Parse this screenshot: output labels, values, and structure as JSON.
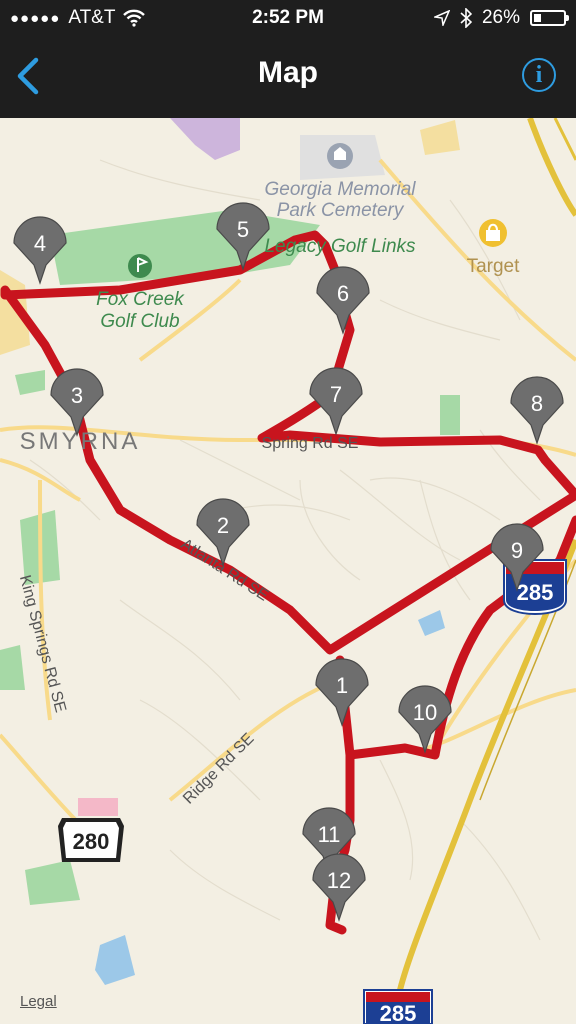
{
  "status_bar": {
    "signal": "●●●●●",
    "carrier": "AT&T",
    "time": "2:52 PM",
    "battery": "26%",
    "battery_level": 0.26
  },
  "nav": {
    "title": "Map",
    "back_icon": "chevron-left-icon",
    "info_icon": "info-icon",
    "info_glyph": "i"
  },
  "map": {
    "places": {
      "cemetery_1": "Georgia Memorial",
      "cemetery_2": "Park Cemetery",
      "golf_1": "Fox Creek",
      "golf_2": "Golf Club",
      "legacy": "Legacy Golf Links",
      "target": "Target",
      "city": "SMYRNA"
    },
    "roads": {
      "spring": "Spring Rd SE",
      "atlanta": "Atlanta Rd SE",
      "ridge": "Ridge Rd SE",
      "king_springs": "King Springs Rd SE"
    },
    "shields": {
      "i285_top": "285",
      "i285_bottom": "285",
      "us280": "280"
    },
    "legal": "Legal",
    "route_color": "#c8141e",
    "pins": [
      {
        "label": "1"
      },
      {
        "label": "2"
      },
      {
        "label": "3"
      },
      {
        "label": "4"
      },
      {
        "label": "5"
      },
      {
        "label": "6"
      },
      {
        "label": "7"
      },
      {
        "label": "8"
      },
      {
        "label": "9"
      },
      {
        "label": "10"
      },
      {
        "label": "11"
      },
      {
        "label": "12"
      }
    ]
  }
}
